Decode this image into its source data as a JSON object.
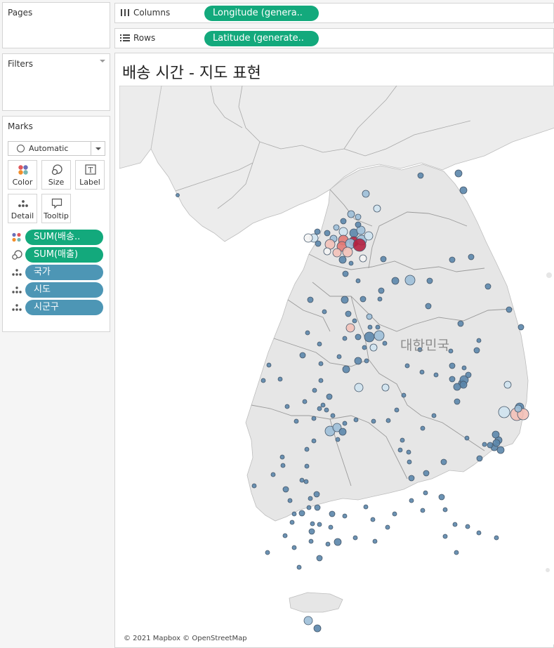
{
  "left_panel": {
    "pages_title": "Pages",
    "filters_title": "Filters",
    "marks_title": "Marks",
    "mark_type": "Automatic",
    "mark_buttons": [
      "Color",
      "Size",
      "Label",
      "Detail",
      "Tooltip"
    ],
    "mark_pills": [
      {
        "label": "SUM(배송..",
        "kind": "color",
        "color": "#13a97c"
      },
      {
        "label": "SUM(매출)",
        "kind": "size",
        "color": "#13a97c"
      },
      {
        "label": "국가",
        "kind": "detail",
        "color": "#4d96b5"
      },
      {
        "label": "시도",
        "kind": "detail",
        "color": "#4d96b5"
      },
      {
        "label": "시군구",
        "kind": "detail",
        "color": "#4d96b5"
      }
    ]
  },
  "shelves": {
    "columns_label": "Columns",
    "columns_pill": "Longitude (genera..",
    "rows_label": "Rows",
    "rows_pill": "Latitude (generate.."
  },
  "view": {
    "title": "배송 시간 - 지도 표현",
    "country_label": "대한민국",
    "attribution": "© 2021 Mapbox © OpenStreetMap"
  },
  "colors": {
    "accent_green": "#13a97c",
    "dimension_blue": "#4d96b5",
    "low_value": "#5b86ab",
    "high_value": "#b5203f",
    "land": "#e8e8e8"
  }
}
